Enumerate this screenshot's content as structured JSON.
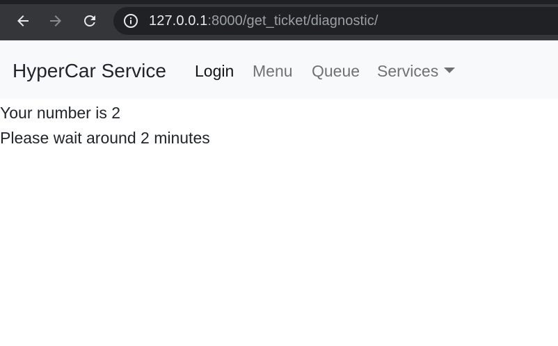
{
  "browser": {
    "url_host": "127.0.0.1",
    "url_rest": ":8000/get_ticket/diagnostic/",
    "icons": {
      "back": "back-arrow-icon",
      "forward": "forward-arrow-icon",
      "reload": "reload-icon",
      "site_info": "info-icon"
    }
  },
  "navbar": {
    "brand": "HyperCar Service",
    "links": {
      "login": "Login",
      "menu": "Menu",
      "queue": "Queue",
      "services": "Services"
    }
  },
  "content": {
    "number_line": "Your number is 2",
    "wait_line": "Please wait around 2 minutes"
  },
  "colors": {
    "browser_chrome": "#35363a",
    "omnibox": "#202124",
    "navbar_bg": "#f8f9fa",
    "active_link": "#212529",
    "muted_link": "#7f7f7f"
  }
}
